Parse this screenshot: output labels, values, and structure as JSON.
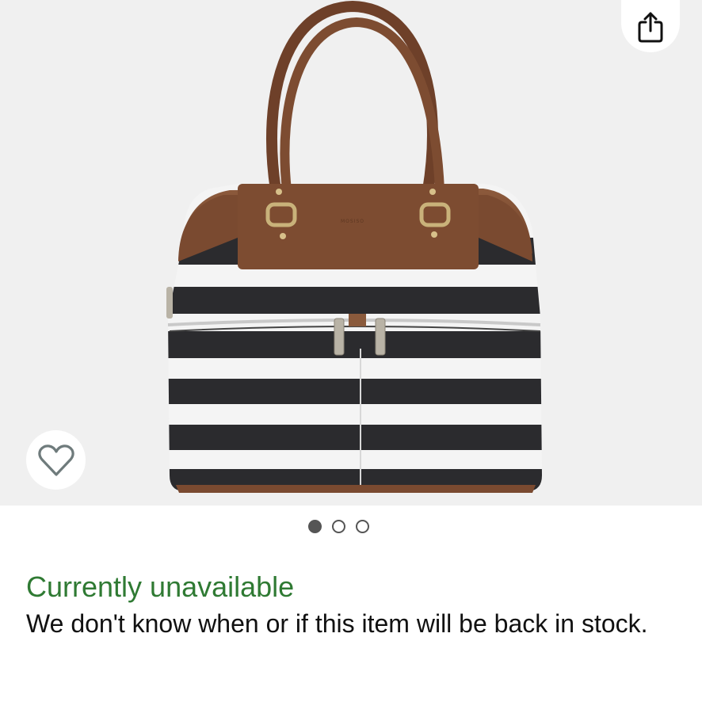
{
  "product": {
    "image": {
      "description_icon": "striped-tote-bag-image",
      "carousel_count": 3,
      "carousel_active_index": 0,
      "brand_stamp": "MOSISO"
    },
    "actions": {
      "share_icon": "share-icon",
      "wishlist_icon": "heart-icon"
    }
  },
  "availability": {
    "title": "Currently unavailable",
    "message": "We don't know when or if this item will be back in stock."
  },
  "colors": {
    "status_green": "#2f7a33",
    "text": "#111111",
    "image_bg": "#f0f0f0",
    "leather": "#7a4a30",
    "stripe_dark": "#2b2b2e"
  }
}
